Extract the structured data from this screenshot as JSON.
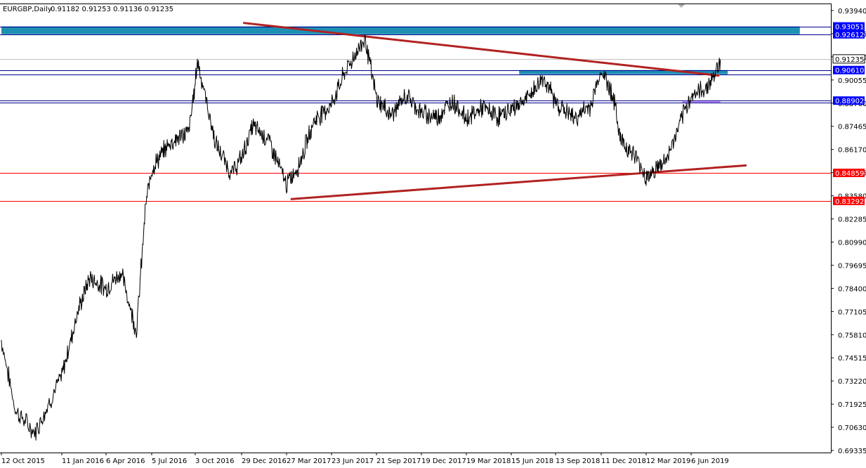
{
  "header": {
    "symbol_label": "EURGBP,Daily",
    "ohlc_text": "0.91182 0.91253 0.91136 0.91235"
  },
  "colors": {
    "background": "#ffffff",
    "price_line": "#000000",
    "support_line": "#ff0000",
    "resistance_line": "#00008b",
    "trend_line": "#b22222",
    "zone_fill": "#1e90b4",
    "zone_purple": "#cc99ff",
    "current_price_tag": "#000000",
    "blue_tag": "#0000ff",
    "red_tag": "#ff0000",
    "axis": "#000000"
  },
  "chart_data": {
    "type": "line",
    "title": "EURGBP,Daily",
    "series": [
      {
        "values_note_skip": false,
        "x": [
          "2015-10-12",
          "2015-11-02",
          "2015-12-01",
          "2016-01-11",
          "2016-02-10",
          "2016-03-05",
          "2016-04-06",
          "2016-05-06",
          "2016-06-05",
          "2016-06-23",
          "2016-07-05",
          "2016-08-10",
          "2016-09-20",
          "2016-10-03",
          "2016-10-07",
          "2016-11-10",
          "2016-12-10",
          "2016-12-29",
          "2017-01-20",
          "2017-02-20",
          "2017-03-27",
          "2017-04-20",
          "2017-05-20",
          "2017-06-23",
          "2017-07-20",
          "2017-08-29",
          "2017-09-21",
          "2017-10-20",
          "2017-11-20",
          "2017-12-19",
          "2018-01-20",
          "2018-02-20",
          "2018-03-19",
          "2018-04-20",
          "2018-05-20",
          "2018-06-15",
          "2018-07-20",
          "2018-08-20",
          "2018-09-13",
          "2018-10-20",
          "2018-11-20",
          "2018-12-11",
          "2019-01-03",
          "2019-01-20",
          "2019-02-20",
          "2019-03-12",
          "2019-04-20",
          "2019-05-20",
          "2019-06-06",
          "2019-07-01",
          "2019-07-20",
          "2019-08-01"
        ],
        "values": [
          0.755,
          0.716,
          0.703,
          0.735,
          0.77,
          0.79,
          0.784,
          0.793,
          0.76,
          0.83,
          0.851,
          0.865,
          0.872,
          0.899,
          0.912,
          0.865,
          0.848,
          0.857,
          0.875,
          0.867,
          0.842,
          0.853,
          0.878,
          0.887,
          0.905,
          0.924,
          0.89,
          0.881,
          0.892,
          0.882,
          0.88,
          0.889,
          0.879,
          0.885,
          0.88,
          0.884,
          0.891,
          0.902,
          0.888,
          0.879,
          0.886,
          0.906,
          0.893,
          0.867,
          0.857,
          0.846,
          0.856,
          0.879,
          0.892,
          0.895,
          0.903,
          0.912
        ]
      }
    ],
    "ylim": [
      0.69335,
      0.9424
    ],
    "y_ticks": [
      "0.93940",
      "0.92645",
      "0.91350",
      "0.90055",
      "0.88760",
      "0.87465",
      "0.86170",
      "0.84875",
      "0.83580",
      "0.82285",
      "0.80990",
      "0.79695",
      "0.78400",
      "0.77105",
      "0.75810",
      "0.74515",
      "0.73220",
      "0.71925",
      "0.70630",
      "0.69335"
    ],
    "x_ticks": [
      "12 Oct 2015",
      "11 Jan 2016",
      "6 Apr 2016",
      "5 Jul 2016",
      "3 Oct 2016",
      "29 Dec 2016",
      "27 Mar 2017",
      "23 Jun 2017",
      "21 Sep 2017",
      "19 Dec 2017",
      "19 Mar 2018",
      "15 Jun 2018",
      "13 Sep 2018",
      "11 Dec 2018",
      "12 Mar 2019",
      "6 Jun 2019"
    ],
    "horizontal_lines": [
      {
        "price": 0.93051,
        "color": "#00008b",
        "label": "0.93051"
      },
      {
        "price": 0.92612,
        "color": "#00008b",
        "label": "0.92612"
      },
      {
        "price": 0.9061,
        "color": "#00008b",
        "label": "0.90610"
      },
      {
        "price": 0.90374,
        "color": "#00008b",
        "label": "0.90374"
      },
      {
        "price": 0.88902,
        "color": "#00008b",
        "label": "0.88902"
      },
      {
        "price": 0.88792,
        "color": "#00008b",
        "label": "0.88792"
      },
      {
        "price": 0.84859,
        "color": "#ff0000",
        "label": "0.84859"
      },
      {
        "price": 0.83292,
        "color": "#ff0000",
        "label": "0.83292"
      }
    ],
    "current_price": {
      "price": 0.91235,
      "label": "0.91235"
    },
    "zones": [
      {
        "from_price": 0.92612,
        "to_price": 0.93051,
        "x_from": "2015-10-12",
        "x_to": "2019-12-31",
        "color": "#1e90b4"
      },
      {
        "from_price": 0.90374,
        "to_price": 0.9061,
        "x_from": "2018-07-01",
        "x_to": "2019-08-15",
        "color": "#1e90b4"
      },
      {
        "from_price": 0.88792,
        "to_price": 0.88902,
        "x_from": "2019-05-20",
        "x_to": "2019-08-01",
        "color": "#cc99ff"
      }
    ],
    "trend_lines": [
      {
        "x1": "2017-01-01",
        "y1": 0.9325,
        "x2": "2019-07-30",
        "y2": 0.903,
        "color": "#b22222"
      },
      {
        "x1": "2017-04-04",
        "y1": 0.8339,
        "x2": "2019-09-20",
        "y2": 0.8528,
        "color": "#b22222"
      }
    ],
    "grid": false,
    "legend": "none"
  }
}
